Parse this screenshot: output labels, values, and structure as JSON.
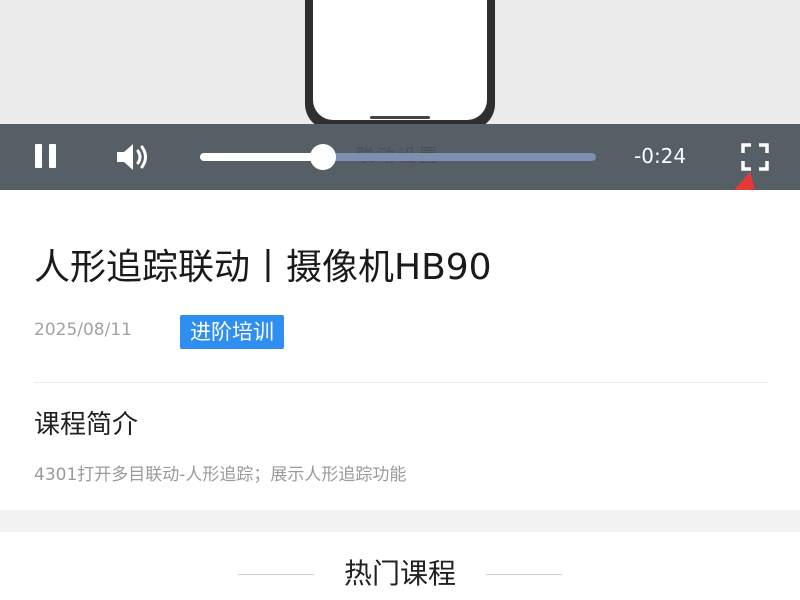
{
  "player": {
    "overlay_text": "联动设置",
    "time_remaining": "-0:24",
    "progress": 0.31,
    "state": "playing",
    "colors": {
      "bar_bg": "#565e66",
      "track": "#7c8fb0",
      "played": "#ffffff"
    }
  },
  "course": {
    "title": "人形追踪联动丨摄像机HB90",
    "date": "2025/08/11",
    "tag": "进阶培训",
    "tag_color": "#2f8ff0",
    "intro_heading": "课程简介",
    "intro_text": "4301打开多目联动-人形追踪；展示人形追踪功能"
  },
  "hot": {
    "title": "热门课程"
  },
  "icons": [
    "pause-icon",
    "volume-icon",
    "fullscreen-icon",
    "red-arrow-annotation"
  ]
}
